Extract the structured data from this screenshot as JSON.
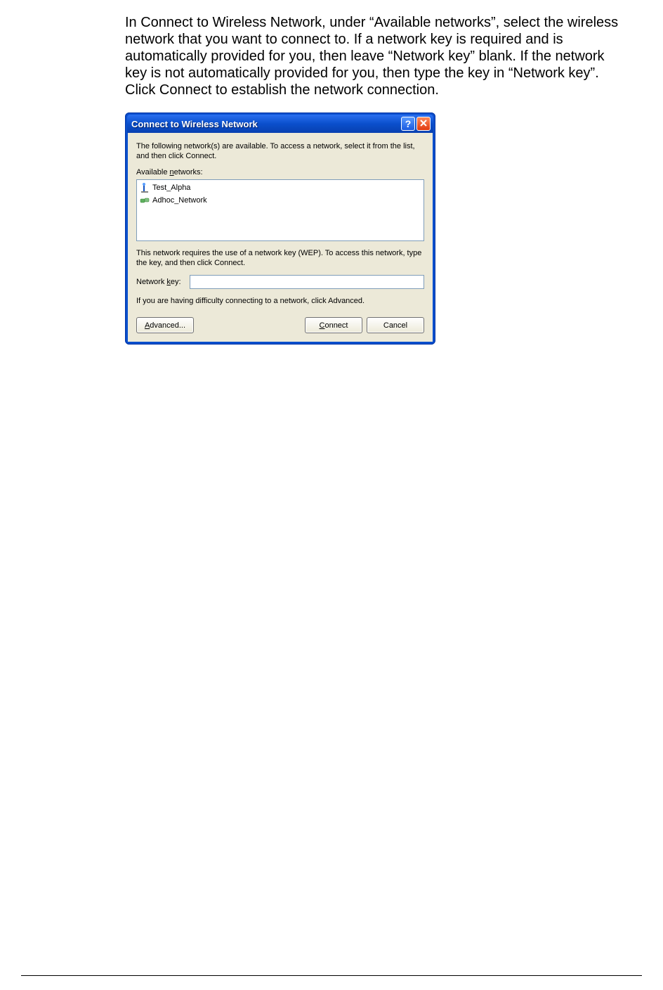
{
  "instructions": "In Connect to Wireless Network, under “Available networks”, select the wireless network that you want to connect to. If a network key is required and is automatically provided for you, then leave “Network key” blank. If the network key is not automatically provided for you, then type the key in “Network key”. Click Connect to establish the network connection.",
  "dialog": {
    "title": "Connect to Wireless Network",
    "intro": "The following network(s) are available. To access a network, select it from the list, and then click Connect.",
    "available_label_pre": "Available ",
    "available_label_u": "n",
    "available_label_post": "etworks:",
    "networks": [
      {
        "name": "Test_Alpha",
        "type": "infrastructure"
      },
      {
        "name": "Adhoc_Network",
        "type": "adhoc"
      }
    ],
    "wep_text": "This network requires the use of a network key (WEP). To access this network, type the key, and then click Connect.",
    "key_label_pre": "Network ",
    "key_label_u": "k",
    "key_label_post": "ey:",
    "key_value": "",
    "difficulty_text": "If you are having difficulty connecting to a network, click Advanced.",
    "buttons": {
      "advanced_u": "A",
      "advanced_rest": "dvanced...",
      "connect_u": "C",
      "connect_rest": "onnect",
      "cancel": "Cancel"
    },
    "help_glyph": "?"
  }
}
